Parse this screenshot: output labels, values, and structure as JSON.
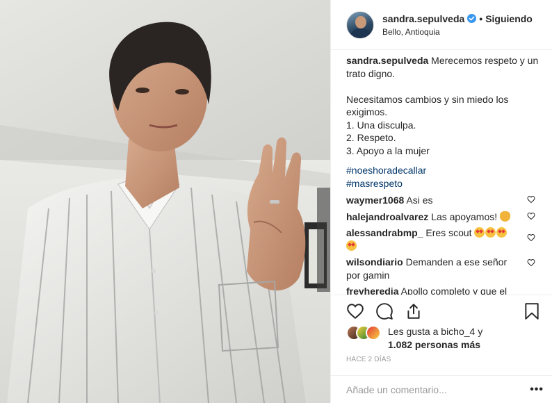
{
  "post": {
    "image_alt": "Mujer con camisa blanca a rayas haciendo el saludo de tres dedos",
    "author": "sandra.sepulveda",
    "follow_status": "Siguiendo",
    "separator": "•",
    "location": "Bello, Antioquia",
    "caption": {
      "username": "sandra.sepulveda",
      "text": " Merecemos respeto y un trato digno.\n\nNecesitamos cambios y sin miedo los exigimos.\n1. Una disculpa.\n2. Respeto.\n3. Apoyo a la mujer"
    },
    "hashtags": [
      "#noeshoradecallar",
      "#masrespeto"
    ],
    "comments": [
      {
        "user": "waymer1068",
        "text": " Asi es"
      },
      {
        "user": "halejandroalvarez",
        "text": " Las apoyamos!"
      },
      {
        "user": "alessandrabmp_",
        "text": " Eres scout "
      },
      {
        "user": "wilsondiario",
        "text": " Demanden a ese señor por gamin"
      },
      {
        "user": "freyheredia",
        "text": " Apollo completo y que el"
      }
    ],
    "likes": {
      "prefix": "Les gusta a ",
      "user": "bicho_4",
      "middle": " y ",
      "others": "1.082 personas más"
    },
    "timestamp": "Hace 2 días",
    "comment_placeholder": "Añade un comentario...",
    "more_options": "•••"
  },
  "icons": {
    "verified": "verified-badge-icon",
    "like": "heart-icon",
    "comment": "comment-icon",
    "share": "share-icon",
    "save": "bookmark-icon"
  },
  "colors": {
    "hashtag": "#003569",
    "verified": "#3897f0",
    "muted": "#999999",
    "text": "#262626"
  }
}
